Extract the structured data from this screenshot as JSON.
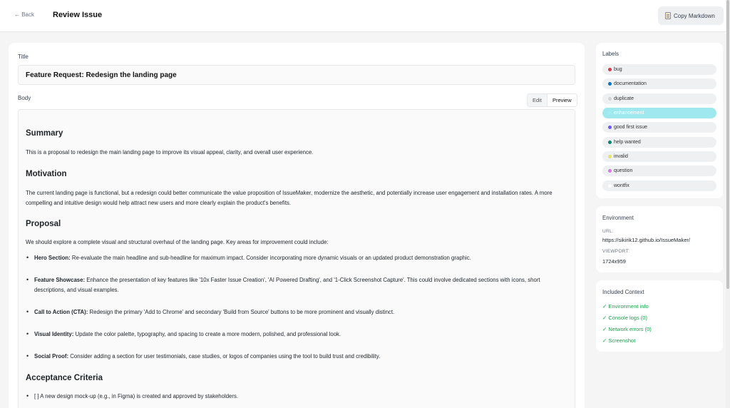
{
  "header": {
    "back_label": "← Back",
    "title": "Review Issue",
    "copy_label": "Copy Markdown"
  },
  "form": {
    "title_label": "Title",
    "title_value": "Feature Request: Redesign the landing page",
    "body_label": "Body",
    "tabs": [
      {
        "label": "Edit",
        "active": false
      },
      {
        "label": "Preview",
        "active": true
      }
    ]
  },
  "preview": {
    "summary_heading": "Summary",
    "summary_text": "This is a proposal to redesign the main landing page to improve its visual appeal, clarity, and overall user experience.",
    "motivation_heading": "Motivation",
    "motivation_text": "The current landing page is functional, but a redesign could better communicate the value proposition of IssueMaker, modernize the aesthetic, and potentially increase user engagement and installation rates. A more compelling and intuitive design would help attract new users and more clearly explain the product's benefits.",
    "proposal_heading": "Proposal",
    "proposal_text": "We should explore a complete visual and structural overhaul of the landing page. Key areas for improvement could include:",
    "bullets": [
      {
        "bold": "Hero Section:",
        "text": " Re-evaluate the main headline and sub-headline for maximum impact. Consider incorporating more dynamic visuals or an updated product demonstration graphic."
      },
      {
        "bold": "Feature Showcase:",
        "text": " Enhance the presentation of key features like '10x Faster Issue Creation', 'AI Powered Drafting', and '1-Click Screenshot Capture'. This could involve dedicated sections with icons, short descriptions, and visual examples."
      },
      {
        "bold": "Call to Action (CTA):",
        "text": " Redesign the primary 'Add to Chrome' and secondary 'Build from Source' buttons to be more prominent and visually distinct."
      },
      {
        "bold": "Visual Identity:",
        "text": " Update the color palette, typography, and spacing to create a more modern, polished, and professional look."
      },
      {
        "bold": "Social Proof:",
        "text": " Consider adding a section for user testimonials, case studies, or logos of companies using the tool to build trust and credibility."
      }
    ],
    "acceptance_heading": "Acceptance Criteria",
    "acceptance_items": [
      "[ ] A new design mock-up (e.g., in Figma) is created and approved by stakeholders."
    ]
  },
  "labels": {
    "title": "Labels",
    "items": [
      {
        "name": "bug",
        "color": "#d73a4a",
        "selected": false
      },
      {
        "name": "documentation",
        "color": "#0075ca",
        "selected": false
      },
      {
        "name": "duplicate",
        "color": "#cfd3d7",
        "selected": false
      },
      {
        "name": "enhancement",
        "color": "#a2eeef",
        "selected": true
      },
      {
        "name": "good first issue",
        "color": "#7057ff",
        "selected": false
      },
      {
        "name": "help wanted",
        "color": "#008672",
        "selected": false
      },
      {
        "name": "invalid",
        "color": "#e4e669",
        "selected": false
      },
      {
        "name": "question",
        "color": "#d876e3",
        "selected": false
      },
      {
        "name": "wontfix",
        "color": "#ffffff",
        "selected": false
      }
    ]
  },
  "environment": {
    "title": "Environment",
    "url_key": "URL:",
    "url_value": "https://sikirik12.github.io/IssueMaker/",
    "viewport_key": "VIEWPORT:",
    "viewport_value": "1724x959"
  },
  "context": {
    "title": "Included Context",
    "items": [
      "✓ Environment info",
      "✓ Console logs (0)",
      "✓ Network errors (0)",
      "✓ Screenshot"
    ]
  }
}
